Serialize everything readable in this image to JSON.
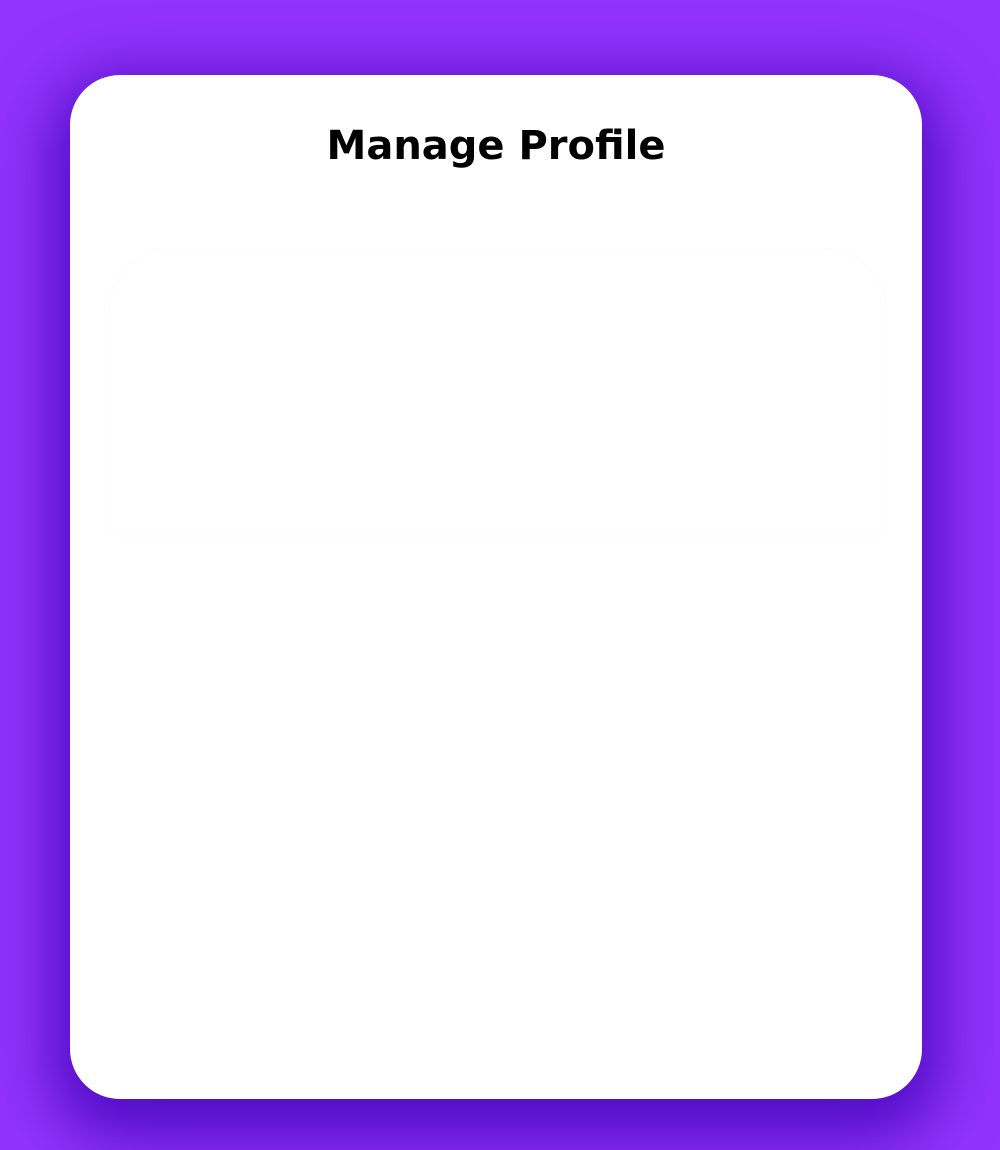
{
  "page": {
    "title": "Manage Profile",
    "colors": {
      "background": "#9233fb",
      "card": "#ffffff",
      "shadow": "#4a10c0"
    }
  }
}
